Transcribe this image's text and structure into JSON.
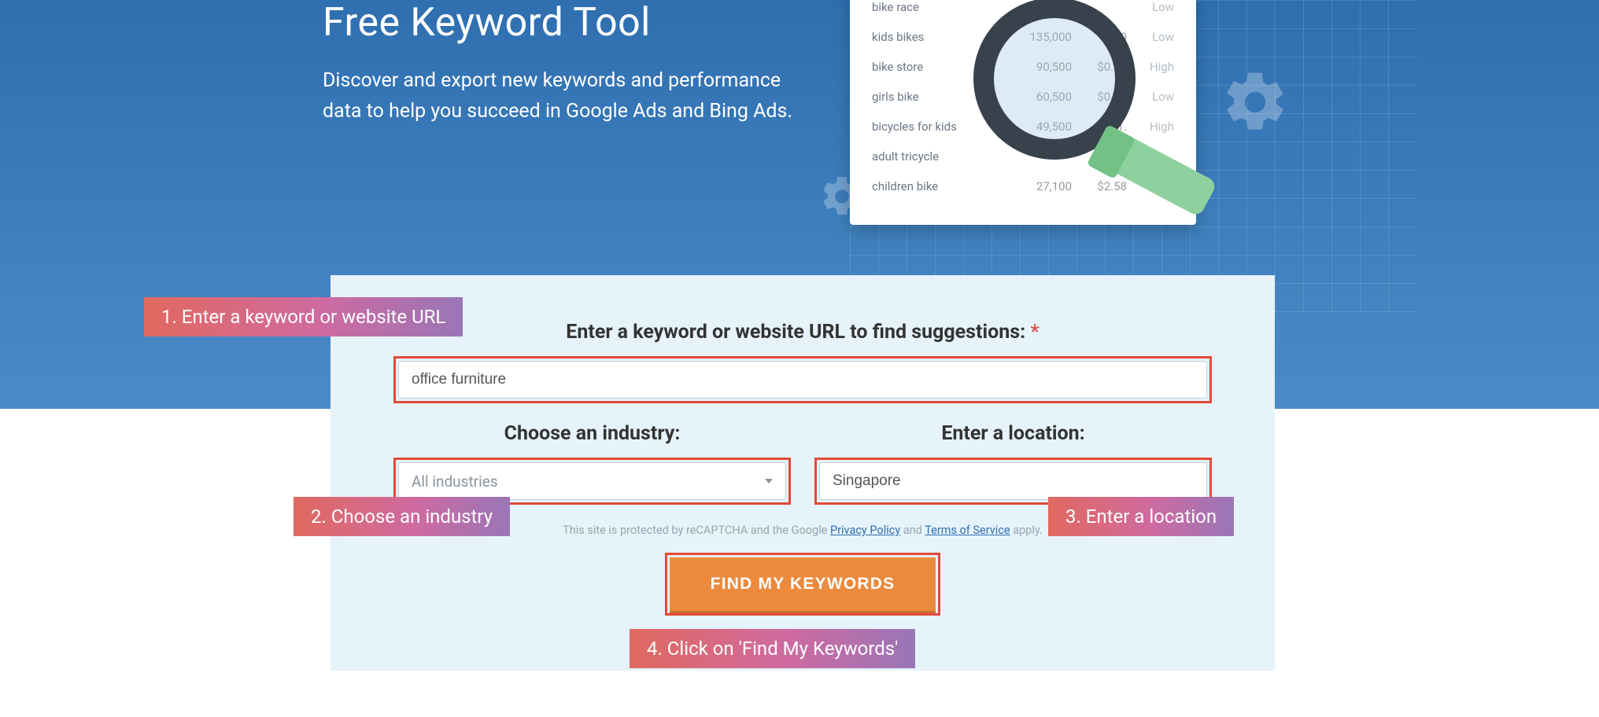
{
  "hero": {
    "title": "Free Keyword Tool",
    "subtitle": "Discover and export new keywords and performance data to help you succeed in Google Ads and Bing Ads."
  },
  "preview_rows": [
    {
      "kw": "bike race",
      "vol": "",
      "cpc": "",
      "comp": "Low"
    },
    {
      "kw": "kids bikes",
      "vol": "135,000",
      "cpc": "$2.0",
      "comp": "Low"
    },
    {
      "kw": "bike store",
      "vol": "90,500",
      "cpc": "$0.56",
      "comp": "High"
    },
    {
      "kw": "girls bike",
      "vol": "60,500",
      "cpc": "$0.92",
      "comp": "Low"
    },
    {
      "kw": "bicycles for kids",
      "vol": "49,500",
      "cpc": "$1.",
      "comp": "High"
    },
    {
      "kw": "adult tricycle",
      "vol": "",
      "cpc": "0",
      "comp": ""
    },
    {
      "kw": "children bike",
      "vol": "27,100",
      "cpc": "$2.58",
      "comp": ""
    }
  ],
  "form": {
    "main_label": "Enter a keyword or website URL to find suggestions:",
    "required": "*",
    "keyword_value": "office furniture",
    "industry_label": "Choose an industry:",
    "industry_value": "All industries",
    "location_label": "Enter a location:",
    "location_value": "Singapore",
    "recaptcha_prefix": "This site is protected by reCAPTCHA and the Google ",
    "privacy": "Privacy Policy",
    "and": " and ",
    "tos": "Terms of Service",
    "recaptcha_suffix": " apply.",
    "button": "FIND MY KEYWORDS"
  },
  "callouts": {
    "c1": "1. Enter a keyword or website URL",
    "c2": "2. Choose an industry",
    "c3": "3. Enter a location",
    "c4": "4. Click on 'Find My Keywords'"
  }
}
